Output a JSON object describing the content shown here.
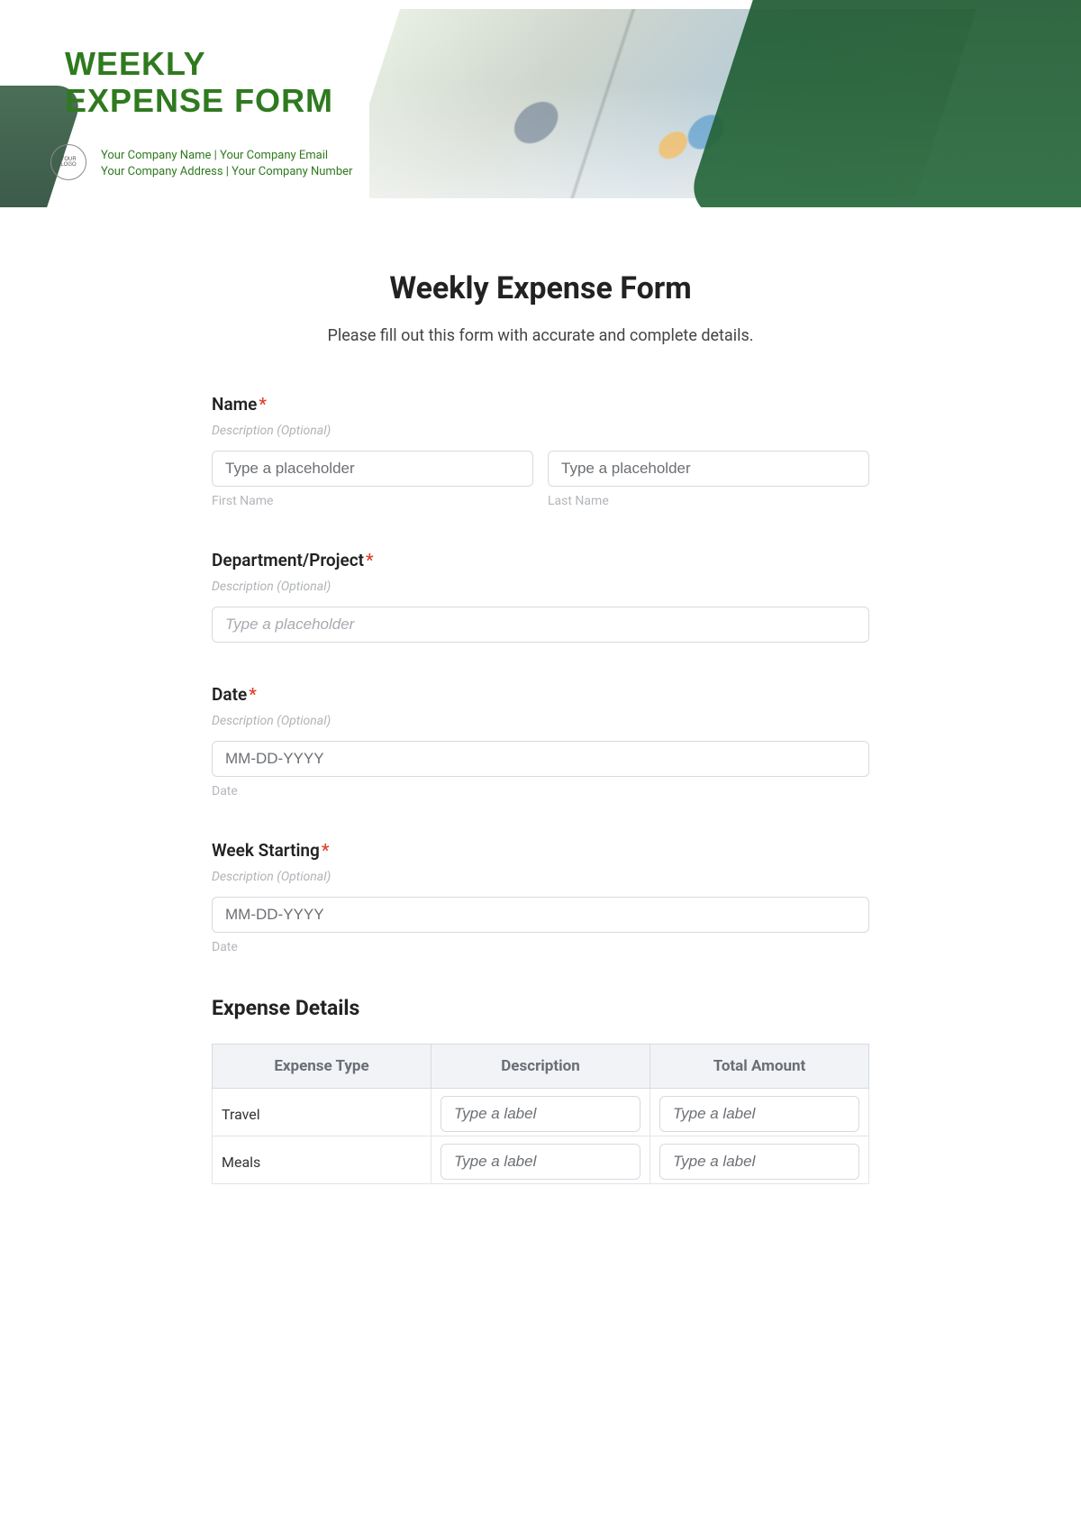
{
  "header": {
    "title_line1": "WEEKLY",
    "title_line2": "EXPENSE FORM",
    "logo_text": "YOUR\nLOGO",
    "company_line1": "Your Company Name  |  Your Company Email",
    "company_line2": "Your Company Address  |  Your Company Number"
  },
  "form": {
    "title": "Weekly Expense Form",
    "subtitle": "Please fill out this form with accurate and complete details.",
    "desc_placeholder": "Description (Optional)",
    "fields": {
      "name": {
        "label": "Name",
        "first_placeholder": "Type a placeholder",
        "first_sub": "First Name",
        "last_placeholder": "Type a placeholder",
        "last_sub": "Last Name"
      },
      "department": {
        "label": "Department/Project",
        "placeholder": "Type a placeholder"
      },
      "date": {
        "label": "Date",
        "placeholder": "MM-DD-YYYY",
        "sub": "Date"
      },
      "week_starting": {
        "label": "Week Starting",
        "placeholder": "MM-DD-YYYY",
        "sub": "Date"
      }
    },
    "expense_section_title": "Expense Details",
    "table": {
      "headers": [
        "Expense Type",
        "Description",
        "Total Amount"
      ],
      "cell_placeholder": "Type a label",
      "rows": [
        {
          "type": "Travel"
        },
        {
          "type": "Meals"
        }
      ]
    }
  }
}
